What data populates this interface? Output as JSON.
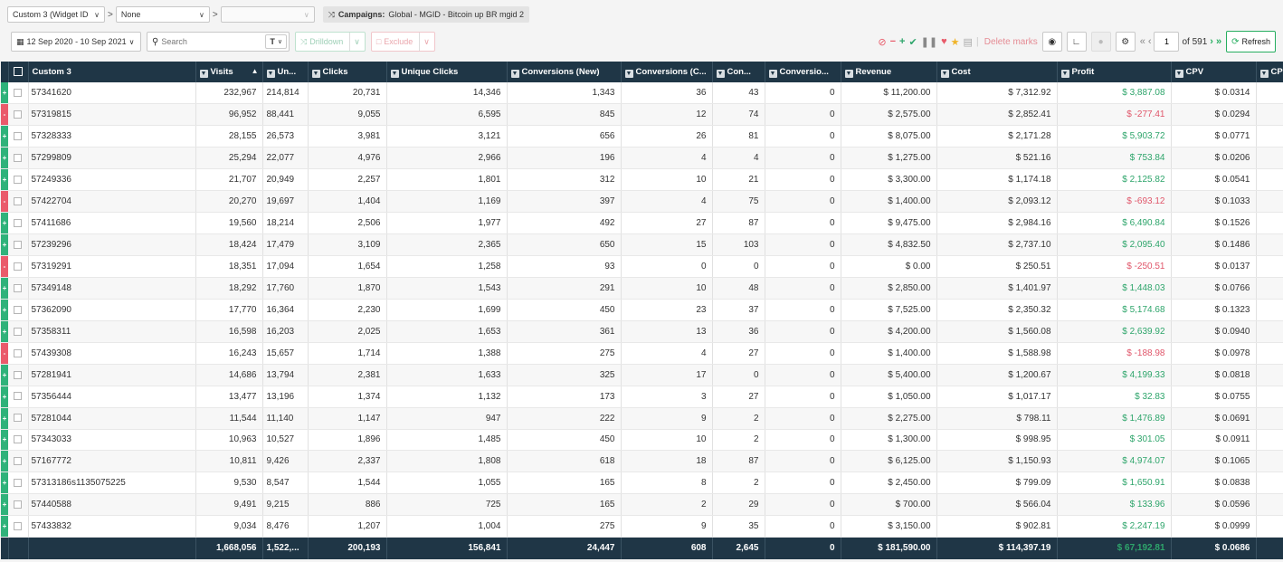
{
  "filters": {
    "group1": "Custom 3 (Widget ID",
    "group2": "None",
    "group3": "",
    "separator": ">",
    "campaign_prefix": "Campaigns:",
    "campaign_name": "Global - MGID - Bitcoin up BR mgid 2"
  },
  "toolbar": {
    "date_range": "12 Sep 2020 - 10 Sep 2021",
    "search_placeholder": "Search",
    "text_toggle": "T",
    "drilldown_label": "Drilldown",
    "exclude_label": "Exclude",
    "delete_marks_label": "Delete marks",
    "page_current": "1",
    "page_total_label": "of 591",
    "refresh_label": "Refresh"
  },
  "columns": [
    "Custom 3",
    "Visits",
    "Un...",
    "Clicks",
    "Unique Clicks",
    "Conversions (New)",
    "Conversions (C...",
    "Con...",
    "Conversio...",
    "Revenue",
    "Cost",
    "Profit",
    "CPV",
    "CP"
  ],
  "rows": [
    {
      "mark": "+",
      "name": "57341620",
      "visits": "232,967",
      "unique": "214,814",
      "clicks": "20,731",
      "unique_clicks": "14,346",
      "conv_new": "1,343",
      "conv_c": "36",
      "con": "43",
      "conversio": "0",
      "revenue": "$ 11,200.00",
      "cost": "$ 7,312.92",
      "profit": "$ 3,887.08",
      "cpv": "$ 0.0314"
    },
    {
      "mark": "-",
      "name": "57319815",
      "visits": "96,952",
      "unique": "88,441",
      "clicks": "9,055",
      "unique_clicks": "6,595",
      "conv_new": "845",
      "conv_c": "12",
      "con": "74",
      "conversio": "0",
      "revenue": "$ 2,575.00",
      "cost": "$ 2,852.41",
      "profit": "$ -277.41",
      "cpv": "$ 0.0294"
    },
    {
      "mark": "+",
      "name": "57328333",
      "visits": "28,155",
      "unique": "26,573",
      "clicks": "3,981",
      "unique_clicks": "3,121",
      "conv_new": "656",
      "conv_c": "26",
      "con": "81",
      "conversio": "0",
      "revenue": "$ 8,075.00",
      "cost": "$ 2,171.28",
      "profit": "$ 5,903.72",
      "cpv": "$ 0.0771"
    },
    {
      "mark": "+",
      "name": "57299809",
      "visits": "25,294",
      "unique": "22,077",
      "clicks": "4,976",
      "unique_clicks": "2,966",
      "conv_new": "196",
      "conv_c": "4",
      "con": "4",
      "conversio": "0",
      "revenue": "$ 1,275.00",
      "cost": "$ 521.16",
      "profit": "$ 753.84",
      "cpv": "$ 0.0206"
    },
    {
      "mark": "+",
      "name": "57249336",
      "visits": "21,707",
      "unique": "20,949",
      "clicks": "2,257",
      "unique_clicks": "1,801",
      "conv_new": "312",
      "conv_c": "10",
      "con": "21",
      "conversio": "0",
      "revenue": "$ 3,300.00",
      "cost": "$ 1,174.18",
      "profit": "$ 2,125.82",
      "cpv": "$ 0.0541"
    },
    {
      "mark": "-",
      "name": "57422704",
      "visits": "20,270",
      "unique": "19,697",
      "clicks": "1,404",
      "unique_clicks": "1,169",
      "conv_new": "397",
      "conv_c": "4",
      "con": "75",
      "conversio": "0",
      "revenue": "$ 1,400.00",
      "cost": "$ 2,093.12",
      "profit": "$ -693.12",
      "cpv": "$ 0.1033"
    },
    {
      "mark": "+",
      "name": "57411686",
      "visits": "19,560",
      "unique": "18,214",
      "clicks": "2,506",
      "unique_clicks": "1,977",
      "conv_new": "492",
      "conv_c": "27",
      "con": "87",
      "conversio": "0",
      "revenue": "$ 9,475.00",
      "cost": "$ 2,984.16",
      "profit": "$ 6,490.84",
      "cpv": "$ 0.1526"
    },
    {
      "mark": "+",
      "name": "57239296",
      "visits": "18,424",
      "unique": "17,479",
      "clicks": "3,109",
      "unique_clicks": "2,365",
      "conv_new": "650",
      "conv_c": "15",
      "con": "103",
      "conversio": "0",
      "revenue": "$ 4,832.50",
      "cost": "$ 2,737.10",
      "profit": "$ 2,095.40",
      "cpv": "$ 0.1486"
    },
    {
      "mark": "-",
      "name": "57319291",
      "visits": "18,351",
      "unique": "17,094",
      "clicks": "1,654",
      "unique_clicks": "1,258",
      "conv_new": "93",
      "conv_c": "0",
      "con": "0",
      "conversio": "0",
      "revenue": "$ 0.00",
      "cost": "$ 250.51",
      "profit": "$ -250.51",
      "cpv": "$ 0.0137"
    },
    {
      "mark": "+",
      "name": "57349148",
      "visits": "18,292",
      "unique": "17,760",
      "clicks": "1,870",
      "unique_clicks": "1,543",
      "conv_new": "291",
      "conv_c": "10",
      "con": "48",
      "conversio": "0",
      "revenue": "$ 2,850.00",
      "cost": "$ 1,401.97",
      "profit": "$ 1,448.03",
      "cpv": "$ 0.0766"
    },
    {
      "mark": "+",
      "name": "57362090",
      "visits": "17,770",
      "unique": "16,364",
      "clicks": "2,230",
      "unique_clicks": "1,699",
      "conv_new": "450",
      "conv_c": "23",
      "con": "37",
      "conversio": "0",
      "revenue": "$ 7,525.00",
      "cost": "$ 2,350.32",
      "profit": "$ 5,174.68",
      "cpv": "$ 0.1323"
    },
    {
      "mark": "+",
      "name": "57358311",
      "visits": "16,598",
      "unique": "16,203",
      "clicks": "2,025",
      "unique_clicks": "1,653",
      "conv_new": "361",
      "conv_c": "13",
      "con": "36",
      "conversio": "0",
      "revenue": "$ 4,200.00",
      "cost": "$ 1,560.08",
      "profit": "$ 2,639.92",
      "cpv": "$ 0.0940"
    },
    {
      "mark": "-",
      "name": "57439308",
      "visits": "16,243",
      "unique": "15,657",
      "clicks": "1,714",
      "unique_clicks": "1,388",
      "conv_new": "275",
      "conv_c": "4",
      "con": "27",
      "conversio": "0",
      "revenue": "$ 1,400.00",
      "cost": "$ 1,588.98",
      "profit": "$ -188.98",
      "cpv": "$ 0.0978"
    },
    {
      "mark": "+",
      "name": "57281941",
      "visits": "14,686",
      "unique": "13,794",
      "clicks": "2,381",
      "unique_clicks": "1,633",
      "conv_new": "325",
      "conv_c": "17",
      "con": "0",
      "conversio": "0",
      "revenue": "$ 5,400.00",
      "cost": "$ 1,200.67",
      "profit": "$ 4,199.33",
      "cpv": "$ 0.0818"
    },
    {
      "mark": "+",
      "name": "57356444",
      "visits": "13,477",
      "unique": "13,196",
      "clicks": "1,374",
      "unique_clicks": "1,132",
      "conv_new": "173",
      "conv_c": "3",
      "con": "27",
      "conversio": "0",
      "revenue": "$ 1,050.00",
      "cost": "$ 1,017.17",
      "profit": "$ 32.83",
      "cpv": "$ 0.0755"
    },
    {
      "mark": "+",
      "name": "57281044",
      "visits": "11,544",
      "unique": "11,140",
      "clicks": "1,147",
      "unique_clicks": "947",
      "conv_new": "222",
      "conv_c": "9",
      "con": "2",
      "conversio": "0",
      "revenue": "$ 2,275.00",
      "cost": "$ 798.11",
      "profit": "$ 1,476.89",
      "cpv": "$ 0.0691"
    },
    {
      "mark": "+",
      "name": "57343033",
      "visits": "10,963",
      "unique": "10,527",
      "clicks": "1,896",
      "unique_clicks": "1,485",
      "conv_new": "450",
      "conv_c": "10",
      "con": "2",
      "conversio": "0",
      "revenue": "$ 1,300.00",
      "cost": "$ 998.95",
      "profit": "$ 301.05",
      "cpv": "$ 0.0911"
    },
    {
      "mark": "+",
      "name": "57167772",
      "visits": "10,811",
      "unique": "9,426",
      "clicks": "2,337",
      "unique_clicks": "1,808",
      "conv_new": "618",
      "conv_c": "18",
      "con": "87",
      "conversio": "0",
      "revenue": "$ 6,125.00",
      "cost": "$ 1,150.93",
      "profit": "$ 4,974.07",
      "cpv": "$ 0.1065"
    },
    {
      "mark": "+",
      "name": "57313186s1135075225",
      "visits": "9,530",
      "unique": "8,547",
      "clicks": "1,544",
      "unique_clicks": "1,055",
      "conv_new": "165",
      "conv_c": "8",
      "con": "2",
      "conversio": "0",
      "revenue": "$ 2,450.00",
      "cost": "$ 799.09",
      "profit": "$ 1,650.91",
      "cpv": "$ 0.0838"
    },
    {
      "mark": "+",
      "name": "57440588",
      "visits": "9,491",
      "unique": "9,215",
      "clicks": "886",
      "unique_clicks": "725",
      "conv_new": "165",
      "conv_c": "2",
      "con": "29",
      "conversio": "0",
      "revenue": "$ 700.00",
      "cost": "$ 566.04",
      "profit": "$ 133.96",
      "cpv": "$ 0.0596"
    },
    {
      "mark": "+",
      "name": "57433832",
      "visits": "9,034",
      "unique": "8,476",
      "clicks": "1,207",
      "unique_clicks": "1,004",
      "conv_new": "275",
      "conv_c": "9",
      "con": "35",
      "conversio": "0",
      "revenue": "$ 3,150.00",
      "cost": "$ 902.81",
      "profit": "$ 2,247.19",
      "cpv": "$ 0.0999"
    }
  ],
  "totals": {
    "visits": "1,668,056",
    "unique": "1,522,...",
    "clicks": "200,193",
    "unique_clicks": "156,841",
    "conv_new": "24,447",
    "conv_c": "608",
    "con": "2,645",
    "conversio": "0",
    "revenue": "$ 181,590.00",
    "cost": "$ 114,397.19",
    "profit": "$ 67,192.81",
    "cpv": "$ 0.0686"
  },
  "colors": {
    "header_bg": "#1f3646",
    "positive": "#2ea56b",
    "negative": "#e0566a",
    "mark_plus": "#2fb27a",
    "mark_minus": "#ea5a6b"
  }
}
